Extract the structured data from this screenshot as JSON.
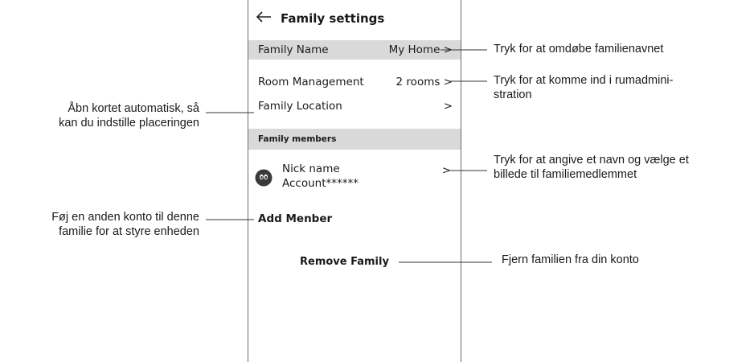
{
  "screen": {
    "title": "Family settings",
    "rows": {
      "family_name": {
        "label": "Family Name",
        "value": "My Home >"
      },
      "room_management": {
        "label": "Room Management",
        "value": "2 rooms >"
      },
      "family_location": {
        "label": "Family Location",
        "value": ">"
      }
    },
    "members_section_title": "Family members",
    "member": {
      "name": "Nick name",
      "account": "Account******",
      "arrow": ">"
    },
    "add_member_label": "Add Menber",
    "remove_family_label": "Remove Family"
  },
  "annotations": {
    "family_name": "Tryk for at omdøbe familienavnet",
    "room_management_line1": "Tryk for at komme ind i rumadmini-",
    "room_management_line2": "stration",
    "location_line1": "Åbn kortet automatisk, så",
    "location_line2": "kan du indstille placeringen",
    "member_line1": "Tryk for at angive et navn og vælge et",
    "member_line2": "billede til familiemedlemmet",
    "add_member_line1": "Føj en anden konto til denne",
    "add_member_line2": "familie for at styre enheden",
    "remove_family": "Fjern familien fra din konto"
  },
  "icons": {
    "back": "arrow-left-icon",
    "avatar": "avatar-icon"
  }
}
